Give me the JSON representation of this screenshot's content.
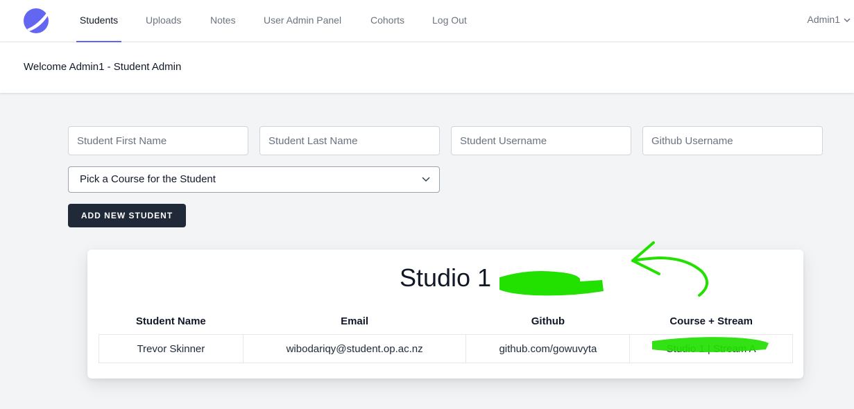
{
  "nav": {
    "items": [
      {
        "label": "Students",
        "active": true
      },
      {
        "label": "Uploads"
      },
      {
        "label": "Notes"
      },
      {
        "label": "User Admin Panel"
      },
      {
        "label": "Cohorts"
      },
      {
        "label": "Log Out"
      }
    ],
    "user": "Admin1"
  },
  "header": {
    "welcome": "Welcome Admin1 - Student Admin"
  },
  "form": {
    "first_name_placeholder": "Student First Name",
    "last_name_placeholder": "Student Last Name",
    "username_placeholder": "Student Username",
    "github_placeholder": "Github Username",
    "course_select": "Pick a Course for the Student",
    "add_button": "ADD NEW STUDENT"
  },
  "card": {
    "title": "Studio 1",
    "columns": [
      "Student Name",
      "Email",
      "Github",
      "Course + Stream"
    ],
    "rows": [
      [
        "Trevor Skinner",
        "wibodariqy@student.op.ac.nz",
        "github.com/gowuvyta",
        "Studio 1 | Stream A"
      ]
    ]
  },
  "colors": {
    "accent": "#6366f1",
    "button": "#1f2937",
    "annotation": "#22e000"
  },
  "icons": {
    "logo": "logo-icon",
    "user_menu": "chevron-down-icon",
    "select": "chevron-down-icon"
  }
}
